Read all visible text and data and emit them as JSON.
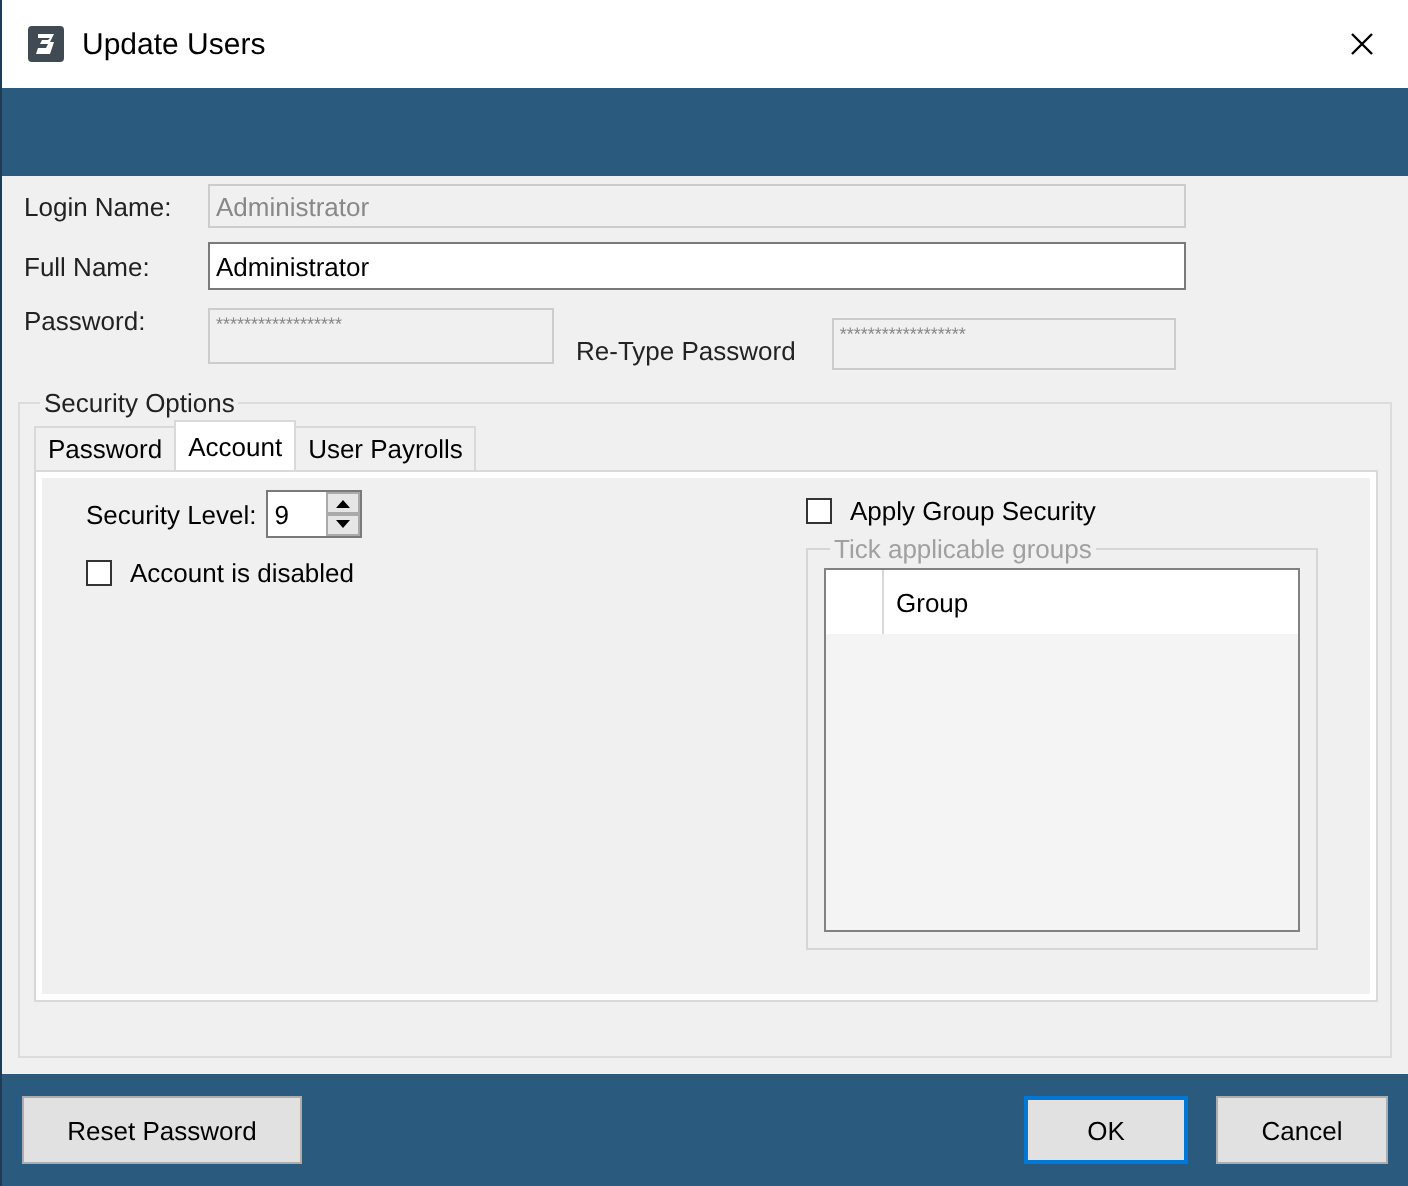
{
  "window": {
    "title": "Update Users"
  },
  "login_name": {
    "label": "Login Name:",
    "value": "Administrator",
    "disabled": true
  },
  "full_name": {
    "label": "Full Name:",
    "value": "Administrator",
    "disabled": false
  },
  "password": {
    "label": "Password:",
    "value": "******************",
    "disabled": true
  },
  "retype_password": {
    "label": "Re-Type Password",
    "value": "******************",
    "disabled": true
  },
  "security_options": {
    "title": "Security Options",
    "tabs": [
      {
        "label": "Password",
        "selected": false
      },
      {
        "label": "Account",
        "selected": true
      },
      {
        "label": "User Payrolls",
        "selected": false
      }
    ],
    "security_level": {
      "label": "Security Level:",
      "value": "9"
    },
    "account_disabled": {
      "label": "Account is disabled",
      "checked": false
    },
    "apply_group_security": {
      "label": "Apply Group Security",
      "checked": false
    },
    "groups": {
      "title": "Tick applicable groups",
      "disabled": true,
      "columns": [
        "Group"
      ]
    }
  },
  "buttons": [
    {
      "label": "Reset Password",
      "default": false
    },
    {
      "label": "OK",
      "default": true
    },
    {
      "label": "Cancel",
      "default": false
    }
  ]
}
